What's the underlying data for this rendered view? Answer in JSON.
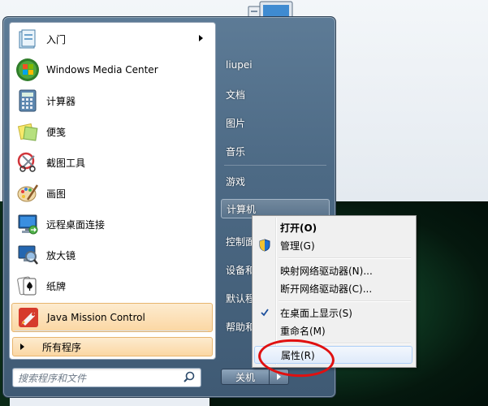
{
  "start_menu": {
    "programs": [
      {
        "label": "入门",
        "icon": "getting-started-icon",
        "has_submenu": true
      },
      {
        "label": "Windows Media Center",
        "icon": "media-center-icon"
      },
      {
        "label": "计算器",
        "icon": "calculator-icon"
      },
      {
        "label": "便笺",
        "icon": "sticky-notes-icon"
      },
      {
        "label": "截图工具",
        "icon": "snipping-tool-icon"
      },
      {
        "label": "画图",
        "icon": "paint-icon"
      },
      {
        "label": "远程桌面连接",
        "icon": "remote-desktop-icon"
      },
      {
        "label": "放大镜",
        "icon": "magnifier-icon"
      },
      {
        "label": "纸牌",
        "icon": "solitaire-icon"
      },
      {
        "label": "Java Mission Control",
        "icon": "java-mission-control-icon"
      }
    ],
    "all_programs": "所有程序",
    "search_placeholder": "搜索程序和文件",
    "right_items": [
      {
        "label": "liupei"
      },
      {
        "label": "文档"
      },
      {
        "label": "图片"
      },
      {
        "label": "音乐"
      },
      {
        "label": "游戏"
      },
      {
        "label": "计算机"
      },
      {
        "label": "控制面"
      },
      {
        "label": "设备和"
      },
      {
        "label": "默认程"
      },
      {
        "label": "帮助和"
      }
    ],
    "shutdown_label": "关机"
  },
  "context_menu": {
    "items": [
      {
        "label": "打开(O)",
        "bold": true
      },
      {
        "label": "管理(G)",
        "icon": "uac-shield-icon"
      },
      {
        "label": "映射网络驱动器(N)..."
      },
      {
        "label": "断开网络驱动器(C)..."
      },
      {
        "label": "在桌面上显示(S)",
        "checked": true
      },
      {
        "label": "重命名(M)"
      },
      {
        "label": "属性(R)",
        "highlighted": true
      }
    ]
  },
  "colors": {
    "annotation": "#e01010",
    "menu_frame": "#4d6a85",
    "highlight": "#fbd7a3"
  }
}
